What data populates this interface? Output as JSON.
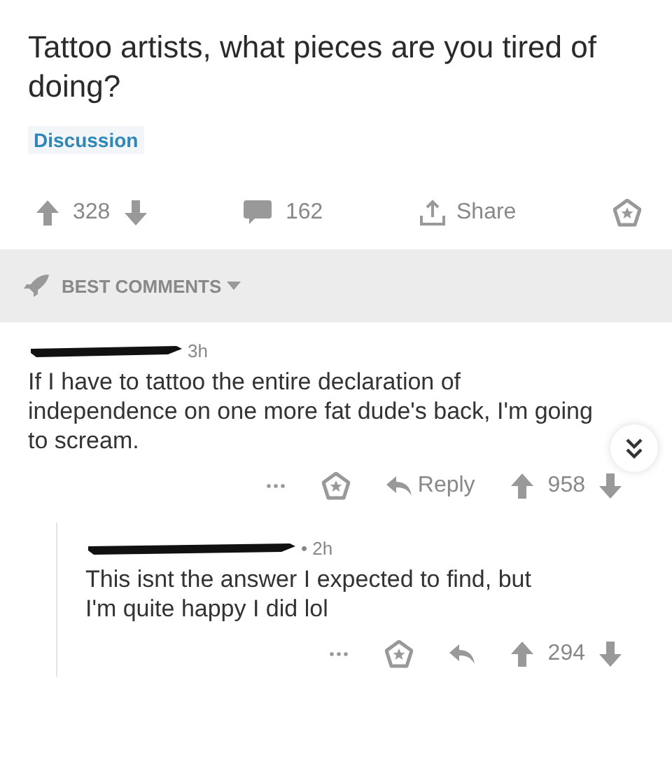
{
  "post": {
    "title": "Tattoo artists, what pieces are you tired of doing?",
    "flair": "Discussion",
    "score": "328",
    "comments": "162",
    "share": "Share"
  },
  "sort": {
    "label": "BEST COMMENTS"
  },
  "comments": [
    {
      "time": "3h",
      "body": "If I have to tattoo the entire declaration of independence on one more fat dude's back, I'm going to scream.",
      "reply": "Reply",
      "score": "958",
      "children": [
        {
          "time": "• 2h",
          "body": "This isnt the answer I expected to find, but I'm quite happy I did lol",
          "score": "294"
        }
      ]
    }
  ]
}
